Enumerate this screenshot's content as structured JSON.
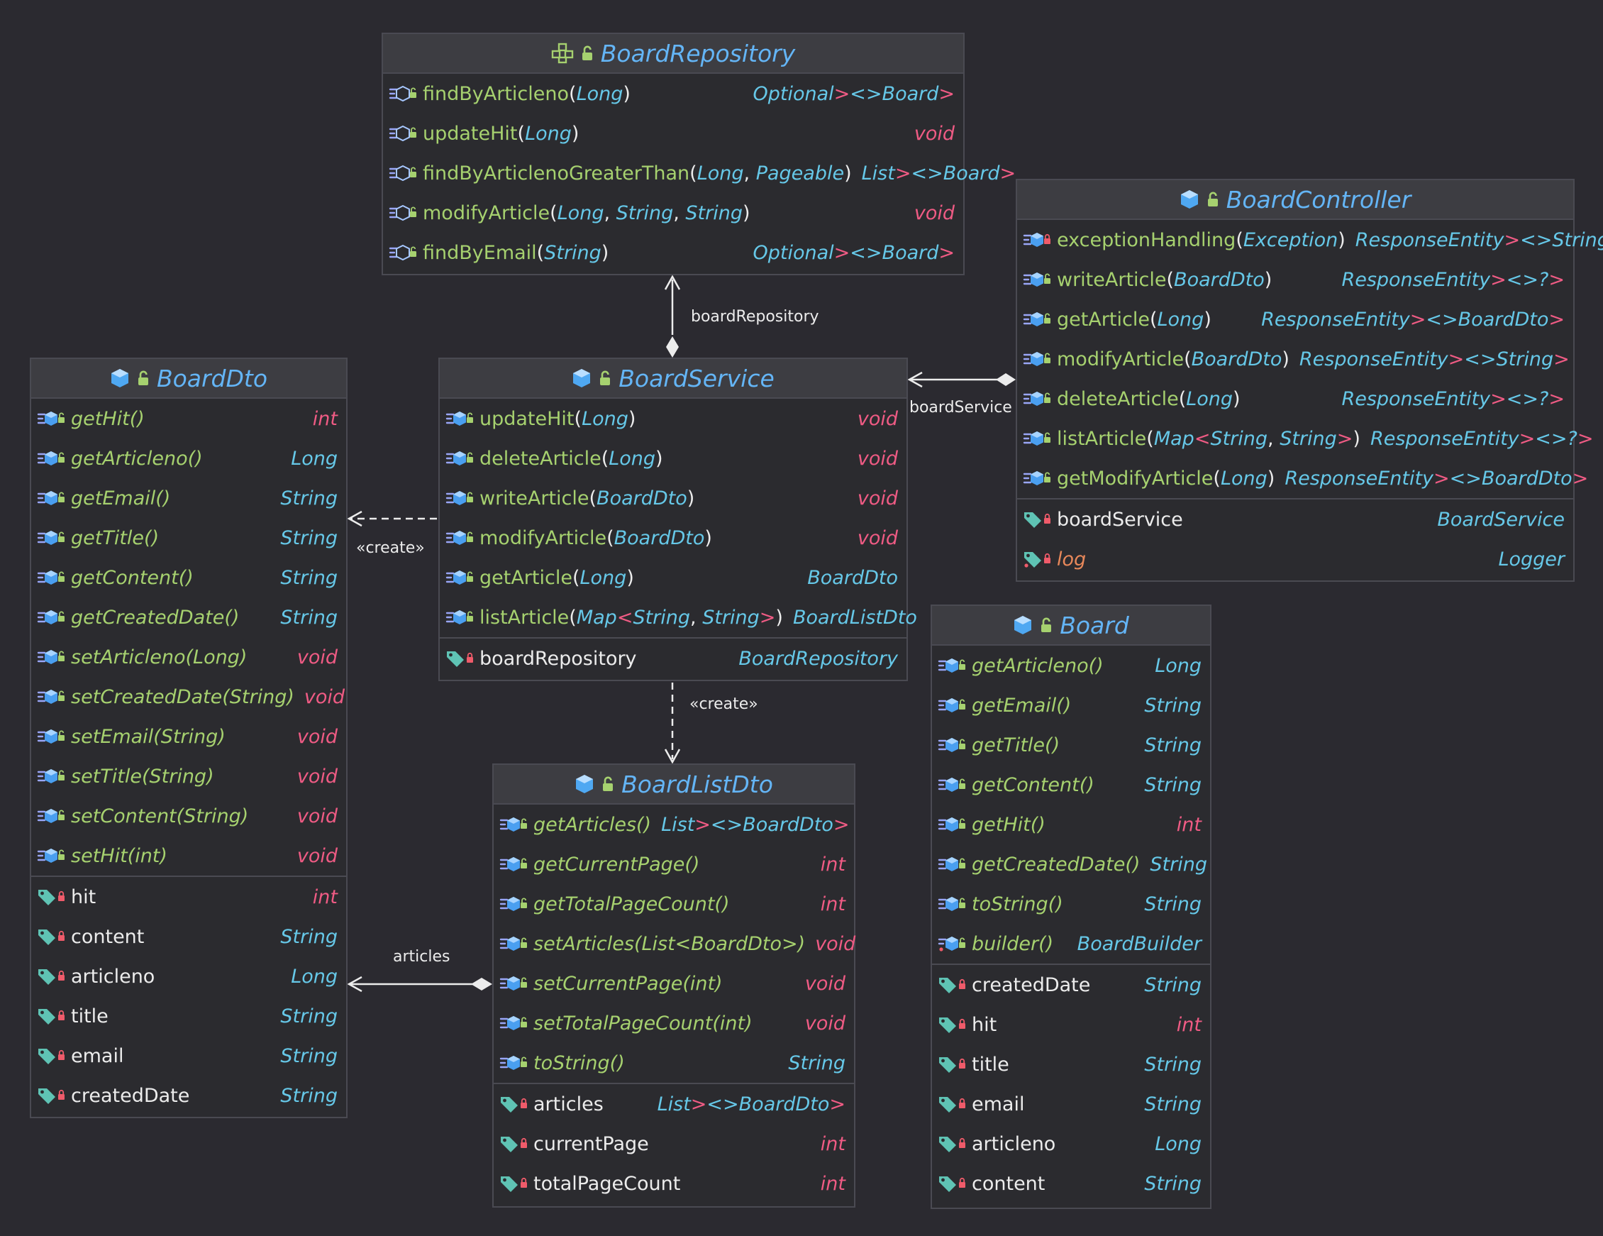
{
  "classes": [
    {
      "id": "BoardRepository",
      "name": "BoardRepository",
      "kind": "interface",
      "methods": [
        {
          "name": "findByArticleno",
          "params": "Long",
          "return": "Optional<Board>"
        },
        {
          "name": "updateHit",
          "params": "Long",
          "return": "void"
        },
        {
          "name": "findByArticlenoGreaterThan",
          "params": "Long, Pageable",
          "return": "List<Board>"
        },
        {
          "name": "modifyArticle",
          "params": "Long, String, String",
          "return": "void"
        },
        {
          "name": "findByEmail",
          "params": "String",
          "return": "Optional<Board>"
        }
      ],
      "fields": []
    },
    {
      "id": "BoardController",
      "name": "BoardController",
      "kind": "class",
      "methods": [
        {
          "name": "exceptionHandling",
          "params": "Exception",
          "return": "ResponseEntity<String>",
          "visibility": "private"
        },
        {
          "name": "writeArticle",
          "params": "BoardDto",
          "return": "ResponseEntity<?>"
        },
        {
          "name": "getArticle",
          "params": "Long",
          "return": "ResponseEntity<BoardDto>"
        },
        {
          "name": "modifyArticle",
          "params": "BoardDto",
          "return": "ResponseEntity<String>"
        },
        {
          "name": "deleteArticle",
          "params": "Long",
          "return": "ResponseEntity<?>"
        },
        {
          "name": "listArticle",
          "params": "Map<String, String>",
          "return": "ResponseEntity<?>"
        },
        {
          "name": "getModifyArticle",
          "params": "Long",
          "return": "ResponseEntity<BoardDto>"
        }
      ],
      "fields": [
        {
          "name": "boardService",
          "type": "BoardService"
        },
        {
          "name": "log",
          "type": "Logger",
          "static": true
        }
      ]
    },
    {
      "id": "BoardDto",
      "name": "BoardDto",
      "kind": "class",
      "methods": [
        {
          "name": "getHit()",
          "return": "int"
        },
        {
          "name": "getArticleno()",
          "return": "Long"
        },
        {
          "name": "getEmail()",
          "return": "String"
        },
        {
          "name": "getTitle()",
          "return": "String"
        },
        {
          "name": "getContent()",
          "return": "String"
        },
        {
          "name": "getCreatedDate()",
          "return": "String"
        },
        {
          "name": "setArticleno(Long)",
          "return": "void"
        },
        {
          "name": "setCreatedDate(String)",
          "return": "void"
        },
        {
          "name": "setEmail(String)",
          "return": "void"
        },
        {
          "name": "setTitle(String)",
          "return": "void"
        },
        {
          "name": "setContent(String)",
          "return": "void"
        },
        {
          "name": "setHit(int)",
          "return": "void"
        }
      ],
      "fields": [
        {
          "name": "hit",
          "type": "int"
        },
        {
          "name": "content",
          "type": "String"
        },
        {
          "name": "articleno",
          "type": "Long"
        },
        {
          "name": "title",
          "type": "String"
        },
        {
          "name": "email",
          "type": "String"
        },
        {
          "name": "createdDate",
          "type": "String"
        }
      ]
    },
    {
      "id": "BoardService",
      "name": "BoardService",
      "kind": "class",
      "methods": [
        {
          "name": "updateHit",
          "params": "Long",
          "return": "void"
        },
        {
          "name": "deleteArticle",
          "params": "Long",
          "return": "void"
        },
        {
          "name": "writeArticle",
          "params": "BoardDto",
          "return": "void"
        },
        {
          "name": "modifyArticle",
          "params": "BoardDto",
          "return": "void"
        },
        {
          "name": "getArticle",
          "params": "Long",
          "return": "BoardDto"
        },
        {
          "name": "listArticle",
          "params": "Map<String, String>",
          "return": "BoardListDto"
        }
      ],
      "fields": [
        {
          "name": "boardRepository",
          "type": "BoardRepository"
        }
      ]
    },
    {
      "id": "Board",
      "name": "Board",
      "kind": "class",
      "methods": [
        {
          "name": "getArticleno()",
          "return": "Long"
        },
        {
          "name": "getEmail()",
          "return": "String"
        },
        {
          "name": "getTitle()",
          "return": "String"
        },
        {
          "name": "getContent()",
          "return": "String"
        },
        {
          "name": "getHit()",
          "return": "int"
        },
        {
          "name": "getCreatedDate()",
          "return": "String"
        },
        {
          "name": "toString()",
          "return": "String"
        },
        {
          "name": "builder()",
          "return": "BoardBuilder",
          "static": true
        }
      ],
      "fields": [
        {
          "name": "createdDate",
          "type": "String"
        },
        {
          "name": "hit",
          "type": "int"
        },
        {
          "name": "title",
          "type": "String"
        },
        {
          "name": "email",
          "type": "String"
        },
        {
          "name": "articleno",
          "type": "Long"
        },
        {
          "name": "content",
          "type": "String"
        }
      ]
    },
    {
      "id": "BoardListDto",
      "name": "BoardListDto",
      "kind": "class",
      "methods": [
        {
          "name": "getArticles()",
          "return": "List<BoardDto>"
        },
        {
          "name": "getCurrentPage()",
          "return": "int"
        },
        {
          "name": "getTotalPageCount()",
          "return": "int"
        },
        {
          "name": "setArticles(List<BoardDto>)",
          "return": "void"
        },
        {
          "name": "setCurrentPage(int)",
          "return": "void"
        },
        {
          "name": "setTotalPageCount(int)",
          "return": "void"
        },
        {
          "name": "toString()",
          "return": "String"
        }
      ],
      "fields": [
        {
          "name": "articles",
          "type": "List<BoardDto>"
        },
        {
          "name": "currentPage",
          "type": "int"
        },
        {
          "name": "totalPageCount",
          "type": "int"
        }
      ]
    }
  ],
  "links": [
    {
      "id": "service-repository",
      "label": "boardRepository",
      "type": "composition"
    },
    {
      "id": "controller-service",
      "label": "boardService",
      "type": "composition"
    },
    {
      "id": "service-dto",
      "label": "«create»",
      "type": "dependency"
    },
    {
      "id": "service-listdto",
      "label": "«create»",
      "type": "dependency"
    },
    {
      "id": "listdto-dto",
      "label": "articles",
      "type": "composition"
    }
  ],
  "colors": {
    "background": "#2b2a30",
    "header": "#3d3d42",
    "border": "#4a4a52",
    "title": "#64b5f6",
    "method": "#a6d16f",
    "type": "#66c8e8",
    "primitive": "#ef5b84",
    "field": "#ececec",
    "static_field": "#e8885a"
  }
}
